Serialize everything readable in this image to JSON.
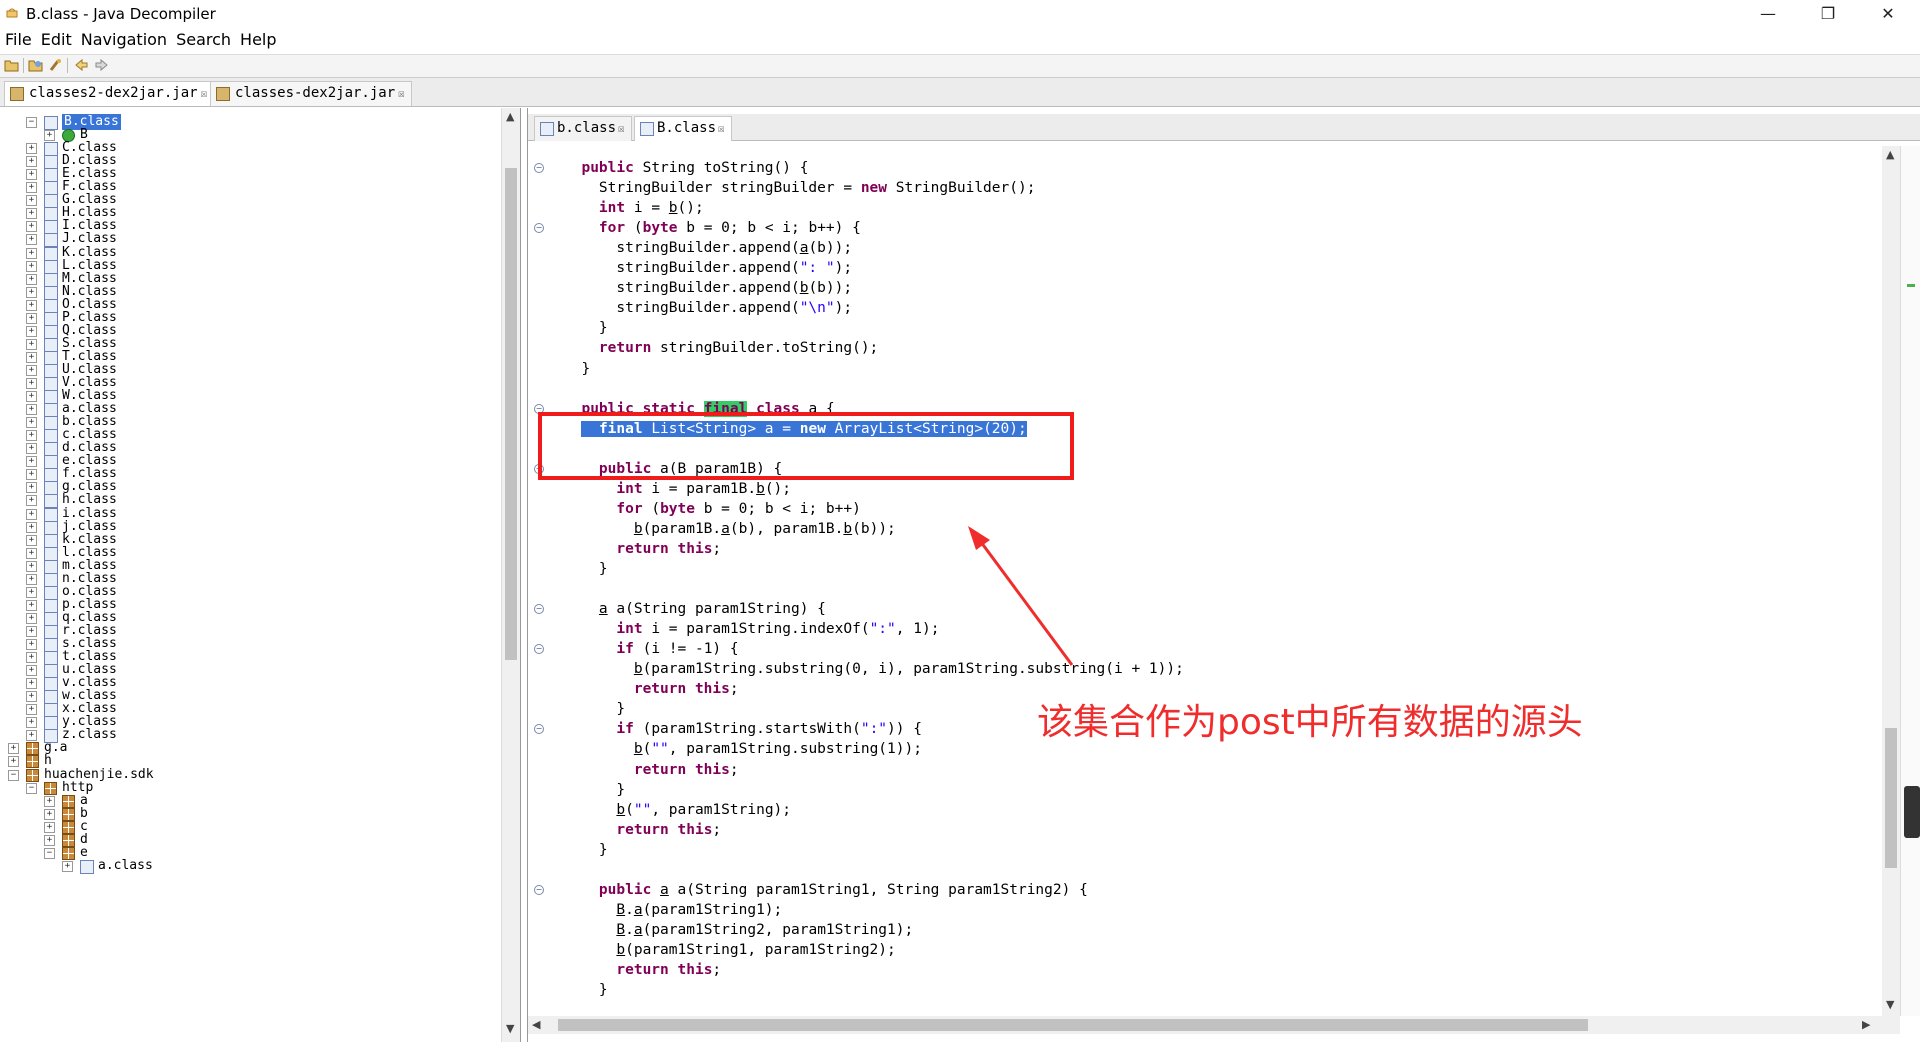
{
  "window": {
    "title": "B.class - Java Decompiler",
    "controls": {
      "minimize": "—",
      "maximize": "❐",
      "close": "✕"
    }
  },
  "menu": [
    "File",
    "Edit",
    "Navigation",
    "Search",
    "Help"
  ],
  "jar_tabs": [
    {
      "label": "classes2-dex2jar.jar",
      "close": "☒",
      "active": true
    },
    {
      "label": "classes-dex2jar.jar",
      "close": "☒",
      "active": false
    }
  ],
  "tree": {
    "selected": "B.class",
    "child_B": "B",
    "classes_upper": [
      "C.class",
      "D.class",
      "E.class",
      "F.class",
      "G.class",
      "H.class",
      "I.class",
      "J.class",
      "K.class",
      "L.class",
      "M.class",
      "N.class",
      "O.class",
      "P.class",
      "Q.class",
      "S.class",
      "T.class",
      "U.class",
      "V.class",
      "W.class"
    ],
    "classes_lower": [
      "a.class",
      "b.class",
      "c.class",
      "d.class",
      "e.class",
      "f.class",
      "g.class",
      "h.class",
      "i.class",
      "j.class",
      "k.class",
      "l.class",
      "m.class",
      "n.class",
      "o.class",
      "p.class",
      "q.class",
      "r.class",
      "s.class",
      "t.class",
      "u.class",
      "v.class",
      "w.class",
      "x.class",
      "y.class",
      "z.class"
    ],
    "packages": [
      "g.a",
      "h",
      "huachenjie.sdk"
    ],
    "sub_package": "http",
    "http_children": [
      "a",
      "b",
      "c",
      "d",
      "e"
    ],
    "partial_last": "a.class"
  },
  "editor_tabs": [
    {
      "label": "b.class",
      "close": "☒",
      "active": false
    },
    {
      "label": "B.class",
      "close": "☒",
      "active": true
    }
  ],
  "annotation": "该集合作为post中所有数据的源头",
  "colors": {
    "annotation": "#f02d2d",
    "selection": "#3875d7",
    "keyword": "#7f0055",
    "string": "#2a00ff"
  },
  "code_lines": [
    {
      "fold": true,
      "html": "  <span class='kw'>public</span> String toString() {"
    },
    {
      "fold": false,
      "html": "    StringBuilder stringBuilder = <span class='kw'>new</span> StringBuilder();"
    },
    {
      "fold": false,
      "html": "    <span class='kw'>int</span> i = <span class='u'>b</span>();"
    },
    {
      "fold": true,
      "html": "    <span class='kw'>for</span> (<span class='kw'>byte</span> b = 0; b &lt; i; b++) {"
    },
    {
      "fold": false,
      "html": "      stringBuilder.append(<span class='u'>a</span>(b));"
    },
    {
      "fold": false,
      "html": "      stringBuilder.append(<span class='str'>\": \"</span>);"
    },
    {
      "fold": false,
      "html": "      stringBuilder.append(<span class='u'>b</span>(b));"
    },
    {
      "fold": false,
      "html": "      stringBuilder.append(<span class='str'>\"\\n\"</span>);"
    },
    {
      "fold": false,
      "html": "    }"
    },
    {
      "fold": false,
      "html": "    <span class='kw'>return</span> stringBuilder.toString();"
    },
    {
      "fold": false,
      "html": "  }"
    },
    {
      "fold": false,
      "html": ""
    },
    {
      "fold": true,
      "html": "  <span class='kw'>public static</span> <span class='kw greenhl'>final</span> <span class='kw'>class</span> a {"
    },
    {
      "fold": false,
      "html": "  <span class='hl'>  <span class='kw'>final</span> List&lt;String&gt; a = <span class='kw'>new</span> ArrayList&lt;String&gt;(20);</span>"
    },
    {
      "fold": false,
      "html": ""
    },
    {
      "fold": true,
      "html": "    <span class='kw'>public</span> a(B param1B) {"
    },
    {
      "fold": false,
      "html": "      <span class='kw'>int</span> i = param1B.<span class='u'>b</span>();"
    },
    {
      "fold": false,
      "html": "      <span class='kw'>for</span> (<span class='kw'>byte</span> b = 0; b &lt; i; b++)"
    },
    {
      "fold": false,
      "html": "        <span class='u'>b</span>(param1B.<span class='u'>a</span>(b), param1B.<span class='u'>b</span>(b));"
    },
    {
      "fold": false,
      "html": "      <span class='kw'>return this</span>;"
    },
    {
      "fold": false,
      "html": "    }"
    },
    {
      "fold": false,
      "html": ""
    },
    {
      "fold": true,
      "html": "    <span class='u'>a</span> a(String param1String) {"
    },
    {
      "fold": false,
      "html": "      <span class='kw'>int</span> i = param1String.indexOf(<span class='str'>\":\"</span>, 1);"
    },
    {
      "fold": true,
      "html": "      <span class='kw'>if</span> (i != -1) {"
    },
    {
      "fold": false,
      "html": "        <span class='u'>b</span>(param1String.substring(0, i), param1String.substring(i + 1));"
    },
    {
      "fold": false,
      "html": "        <span class='kw'>return this</span>;"
    },
    {
      "fold": false,
      "html": "      }"
    },
    {
      "fold": true,
      "html": "      <span class='kw'>if</span> (param1String.startsWith(<span class='str'>\":\"</span>)) {"
    },
    {
      "fold": false,
      "html": "        <span class='u'>b</span>(<span class='str'>\"\"</span>, param1String.substring(1));"
    },
    {
      "fold": false,
      "html": "        <span class='kw'>return this</span>;"
    },
    {
      "fold": false,
      "html": "      }"
    },
    {
      "fold": false,
      "html": "      <span class='u'>b</span>(<span class='str'>\"\"</span>, param1String);"
    },
    {
      "fold": false,
      "html": "      <span class='kw'>return this</span>;"
    },
    {
      "fold": false,
      "html": "    }"
    },
    {
      "fold": false,
      "html": ""
    },
    {
      "fold": true,
      "html": "    <span class='kw'>public</span> <span class='u'>a</span> a(String param1String1, String param1String2) {"
    },
    {
      "fold": false,
      "html": "      <span class='u'>B</span>.<span class='u'>a</span>(param1String1);"
    },
    {
      "fold": false,
      "html": "      <span class='u'>B</span>.<span class='u'>a</span>(param1String2, param1String1);"
    },
    {
      "fold": false,
      "html": "      <span class='u'>b</span>(param1String1, param1String2);"
    },
    {
      "fold": false,
      "html": "      <span class='kw'>return this</span>;"
    },
    {
      "fold": false,
      "html": "    }"
    }
  ]
}
